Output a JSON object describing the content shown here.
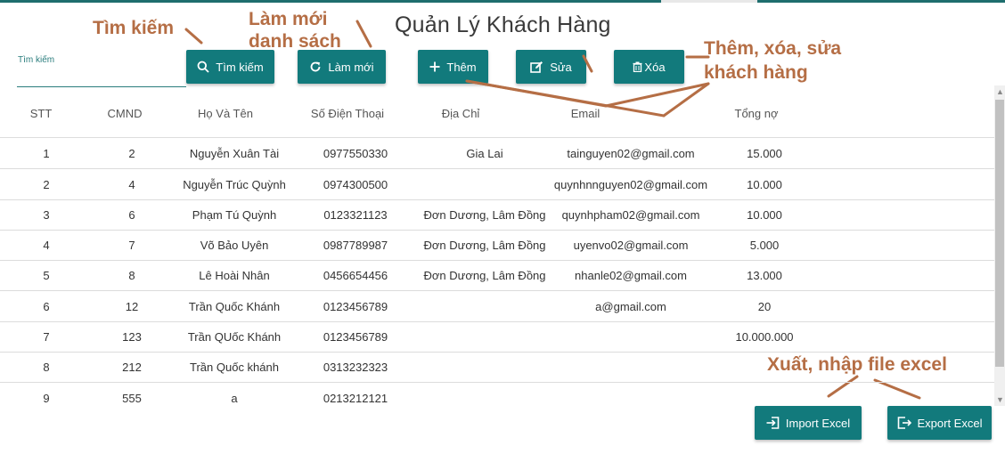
{
  "app": {
    "title": "Quản Lý Khách Hàng"
  },
  "search": {
    "label": "Tìm kiếm",
    "value": ""
  },
  "toolbar": {
    "search_label": "Tìm kiếm",
    "refresh_label": "Làm mới",
    "add_label": "Thêm",
    "edit_label": "Sửa",
    "delete_label": "Xóa"
  },
  "footer": {
    "import_label": "Import Excel",
    "export_label": "Export Excel"
  },
  "annotations": {
    "search": "Tìm kiếm",
    "refresh_line1": "Làm mới",
    "refresh_line2": "danh sách",
    "crud_line1": "Thêm, xóa, sửa",
    "crud_line2": "khách hàng",
    "excel": "Xuất, nhập file excel",
    "color": "#b56e45"
  },
  "table": {
    "headers": [
      "STT",
      "CMND",
      "Họ Và Tên",
      "Số Điện Thoại",
      "Địa Chỉ",
      "Email",
      "Tổng nợ"
    ],
    "rows": [
      [
        "1",
        "2",
        "Nguyễn Xuân Tài",
        "0977550330",
        "Gia Lai",
        "tainguyen02@gmail.com",
        "15.000"
      ],
      [
        "2",
        "4",
        "Nguyễn Trúc Quỳnh",
        "0974300500",
        "",
        "quynhnnguyen02@gmail.com",
        "10.000"
      ],
      [
        "3",
        "6",
        "Phạm Tú Quỳnh",
        "0123321123",
        "Đơn Dương, Lâm Đồng",
        "quynhpham02@gmail.com",
        "10.000"
      ],
      [
        "4",
        "7",
        "Võ Bảo Uyên",
        "0987789987",
        "Đơn Dương, Lâm Đồng",
        "uyenvo02@gmail.com",
        "5.000"
      ],
      [
        "5",
        "8",
        "Lê Hoài Nhân",
        "0456654456",
        "Đơn Dương, Lâm Đồng",
        "nhanle02@gmail.com",
        "13.000"
      ],
      [
        "6",
        "12",
        "Trần Quốc Khánh",
        "0123456789",
        "",
        "a@gmail.com",
        "20"
      ],
      [
        "7",
        "123",
        "Trần QUốc Khánh",
        "0123456789",
        "",
        "",
        "10.000.000"
      ],
      [
        "8",
        "212",
        "Trần Quốc khánh",
        "0313232323",
        "",
        "",
        ""
      ],
      [
        "9",
        "555",
        "a",
        "0213212121",
        "",
        "",
        ""
      ]
    ]
  },
  "colors": {
    "primary": "#127a7c",
    "topbar": "#1e6e6e"
  }
}
